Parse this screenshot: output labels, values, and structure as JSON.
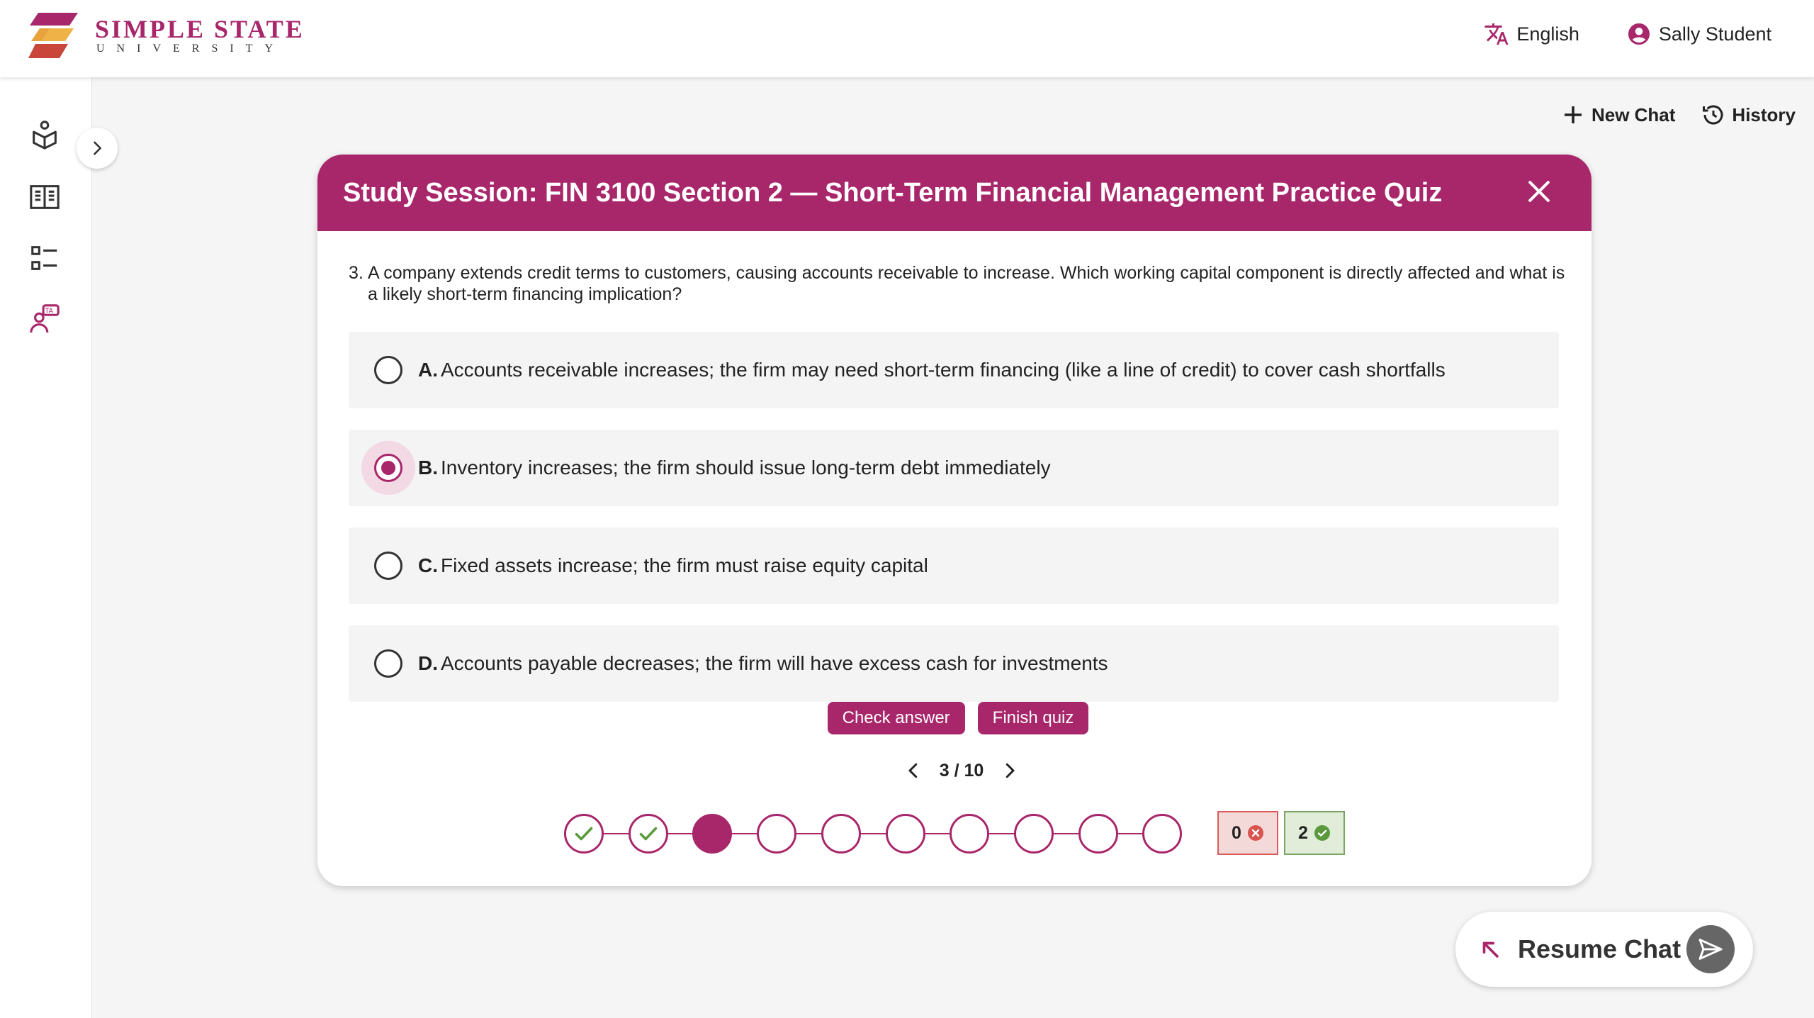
{
  "header": {
    "university_name": "SIMPLE STATE",
    "university_sub": "UNIVERSITY",
    "language_label": "English",
    "user_name": "Sally Student"
  },
  "toolbar": {
    "new_chat_label": "New Chat",
    "history_label": "History"
  },
  "quiz": {
    "title": "Study Session: FIN 3100 Section 2 — Short-Term Financial Management Practice Quiz",
    "question_number": "3.",
    "question_text": "A company extends credit terms to customers, causing accounts receivable to increase. Which working capital component is directly affected and what is a likely short-term financing implication?",
    "options": [
      {
        "letter": "A.",
        "text": "Accounts receivable increases; the firm may need short-term financing (like a line of credit) to cover cash shortfalls",
        "selected": false
      },
      {
        "letter": "B.",
        "text": "Inventory increases; the firm should issue long-term debt immediately",
        "selected": true
      },
      {
        "letter": "C.",
        "text": "Fixed assets increase; the firm must raise equity capital",
        "selected": false
      },
      {
        "letter": "D.",
        "text": "Accounts payable decreases; the firm will have excess cash for investments",
        "selected": false
      }
    ],
    "check_answer_label": "Check answer",
    "finish_quiz_label": "Finish quiz",
    "page_label": "3 / 10",
    "progress": [
      "correct",
      "correct",
      "current",
      "empty",
      "empty",
      "empty",
      "empty",
      "empty",
      "empty",
      "empty"
    ],
    "wrong_count": "0",
    "correct_count": "2"
  },
  "resume_chat_label": "Resume Chat",
  "colors": {
    "brand": "#a8266a",
    "check_green": "#5a9a3c",
    "wrong_red": "#d9534f"
  },
  "icons": [
    "translate-icon",
    "account-circle-icon",
    "plus-icon",
    "history-icon",
    "close-icon",
    "chevron-left-icon",
    "chevron-right-icon",
    "check-icon",
    "send-icon",
    "arrow-up-left-icon"
  ]
}
